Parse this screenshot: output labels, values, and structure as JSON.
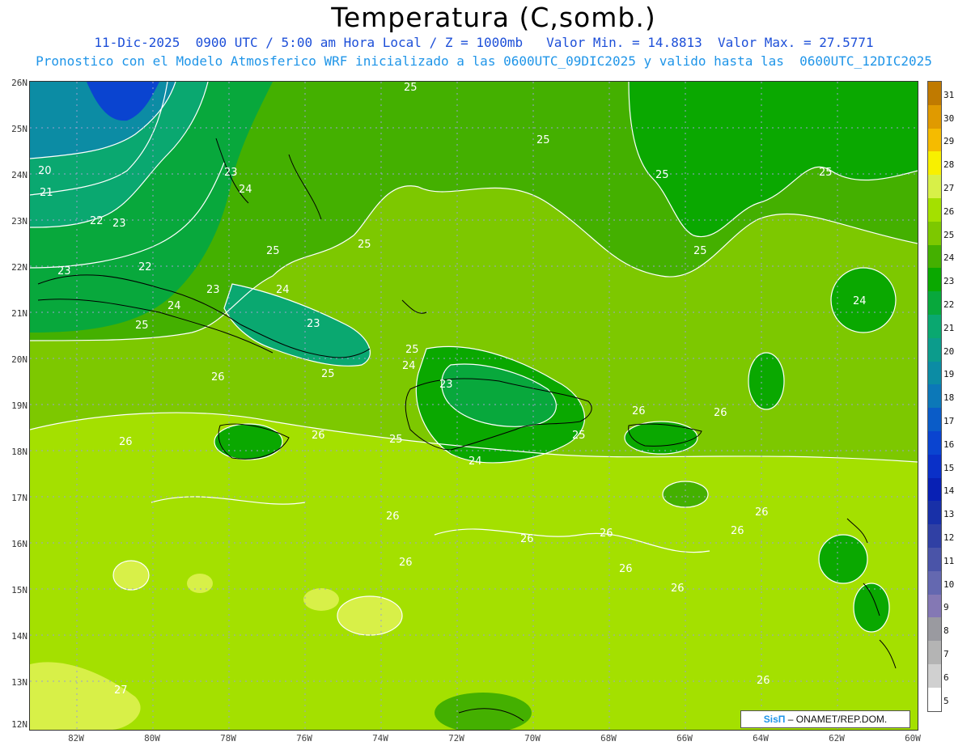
{
  "title": "Temperatura (C,somb.)",
  "subtitle_line1": "11-Dic-2025  0900 UTC / 5:00 am Hora Local / Z = 1000mb   Valor Min. = 14.8813  Valor Max. = 27.5771",
  "subtitle_line2": "Pronostico con el Modelo Atmosferico WRF inicializado a las 0600UTC_09DIC2025 y valido hasta las  0600UTC_12DIC2025",
  "lat_labels": [
    "26N",
    "25N",
    "24N",
    "23N",
    "22N",
    "21N",
    "20N",
    "19N",
    "18N",
    "17N",
    "16N",
    "15N",
    "14N",
    "13N",
    "12N"
  ],
  "lon_labels": [
    "82W",
    "80W",
    "78W",
    "76W",
    "74W",
    "72W",
    "70W",
    "68W",
    "66W",
    "64W",
    "62W",
    "60W"
  ],
  "colorbar": {
    "labels": [
      "31",
      "30",
      "29",
      "28",
      "27",
      "26",
      "25",
      "24",
      "23",
      "22",
      "21",
      "20",
      "19",
      "18",
      "17",
      "16",
      "15",
      "14",
      "13",
      "12",
      "11",
      "10",
      "9",
      "8",
      "7",
      "6",
      "5"
    ],
    "colors": [
      "#c07a00",
      "#e09a00",
      "#f5bb00",
      "#f8f000",
      "#d8f048",
      "#a4e000",
      "#7dc800",
      "#44b000",
      "#0aa800",
      "#08a83c",
      "#0aa870",
      "#0c9c8c",
      "#0c8ca4",
      "#0c78b8",
      "#0a5cc8",
      "#0a44d0",
      "#0a30c8",
      "#0820b4",
      "#1830a8",
      "#3040a4",
      "#4a54a8",
      "#6468b0",
      "#8478b4",
      "#9a9aa0",
      "#b4b4b4",
      "#d0d0d0",
      "#ffffff"
    ]
  },
  "contour_labels": [
    "25",
    "25",
    "25",
    "25",
    "25",
    "25",
    "25",
    "25",
    "25",
    "25",
    "25",
    "25",
    "24",
    "24",
    "24",
    "24",
    "24",
    "24",
    "23",
    "23",
    "23",
    "23",
    "23",
    "23",
    "22",
    "22",
    "21",
    "20",
    "26",
    "26",
    "26",
    "26",
    "26",
    "26",
    "26",
    "26",
    "26",
    "26",
    "26",
    "26",
    "26",
    "26",
    "27"
  ],
  "credit": {
    "brand": "SisΠ",
    "text": " – ONAMET/REP.DOM."
  }
}
